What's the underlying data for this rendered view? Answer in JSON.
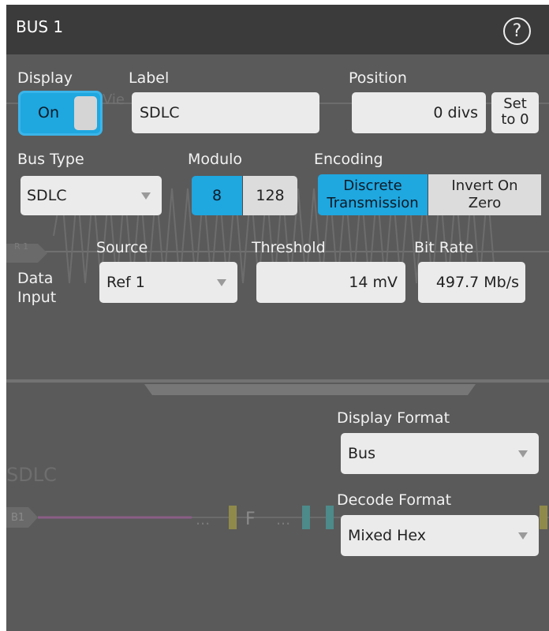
{
  "panel": {
    "title": "BUS 1"
  },
  "display": {
    "label": "Display",
    "toggle_text": "On",
    "state": "on"
  },
  "label_field": {
    "label": "Label",
    "value": "SDLC"
  },
  "position": {
    "label": "Position",
    "value": "0 divs",
    "set_button_line1": "Set",
    "set_button_line2": "to 0"
  },
  "bus_type": {
    "label": "Bus Type",
    "value": "SDLC"
  },
  "modulo": {
    "label": "Modulo",
    "options": [
      "8",
      "128"
    ],
    "selected": "8"
  },
  "encoding": {
    "label": "Encoding",
    "option1_line1": "Discrete",
    "option1_line2": "Transmission",
    "option2_line1": "Invert On",
    "option2_line2": "Zero",
    "selected": "Discrete Transmission"
  },
  "data_input": {
    "label_line1": "Data",
    "label_line2": "Input",
    "source": {
      "label": "Source",
      "value": "Ref 1"
    },
    "threshold": {
      "label": "Threshold",
      "value": "14 mV"
    },
    "bit_rate": {
      "label": "Bit Rate",
      "value": "497.7 Mb/s"
    }
  },
  "display_format": {
    "label": "Display Format",
    "value": "Bus"
  },
  "decode_format": {
    "label": "Decode Format",
    "value": "Mixed Hex"
  },
  "background": {
    "ghost_text": "SDLC",
    "r1_badge": "R 1",
    "b1_badge": "B1",
    "ghost_view": "Vie",
    "ghost_f": "F",
    "ghost_dots": "..."
  },
  "colors": {
    "panel_bg": "#5a5a5a",
    "header_bg": "#3b3b3b",
    "accent": "#1fa7e0",
    "field_bg": "#ebebeb"
  }
}
